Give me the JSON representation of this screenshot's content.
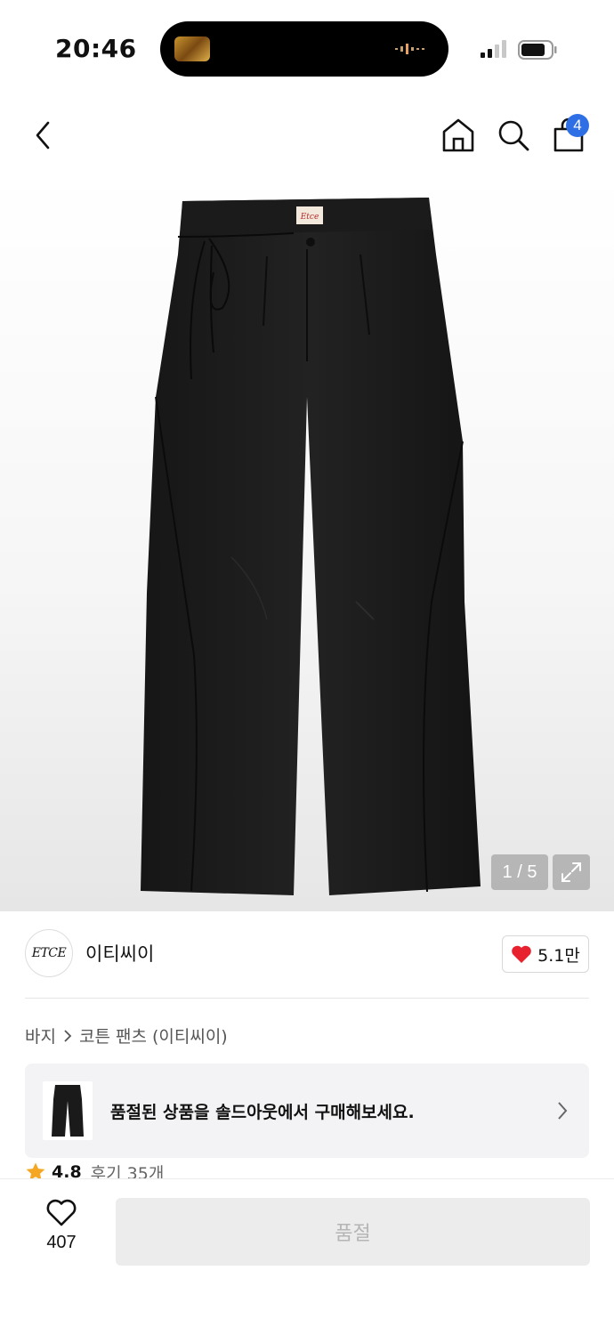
{
  "status_bar": {
    "time": "20:46"
  },
  "nav": {
    "cart_count": "4",
    "icons": [
      "back-chevron-icon",
      "home-icon",
      "search-icon",
      "shopping-bag-icon"
    ]
  },
  "image": {
    "counter": "1 / 5"
  },
  "brand": {
    "logo_text": "ETCE",
    "name": "이티씨이",
    "like_count": "5.1만"
  },
  "breadcrumb": {
    "category": "바지",
    "product": "코튼 팬츠 (이티씨이)"
  },
  "soldout_banner": {
    "text": "품절된 상품을 솔드아웃에서 구매해보세요."
  },
  "rating": {
    "score": "4.8",
    "reviews": "후기 35개"
  },
  "bottom_bar": {
    "wish_count": "407",
    "buy_label": "품절"
  },
  "colors": {
    "badge": "#2f6fe6",
    "heart": "#e8212e",
    "star": "#f5a623",
    "disabled_button": "#ececec"
  }
}
